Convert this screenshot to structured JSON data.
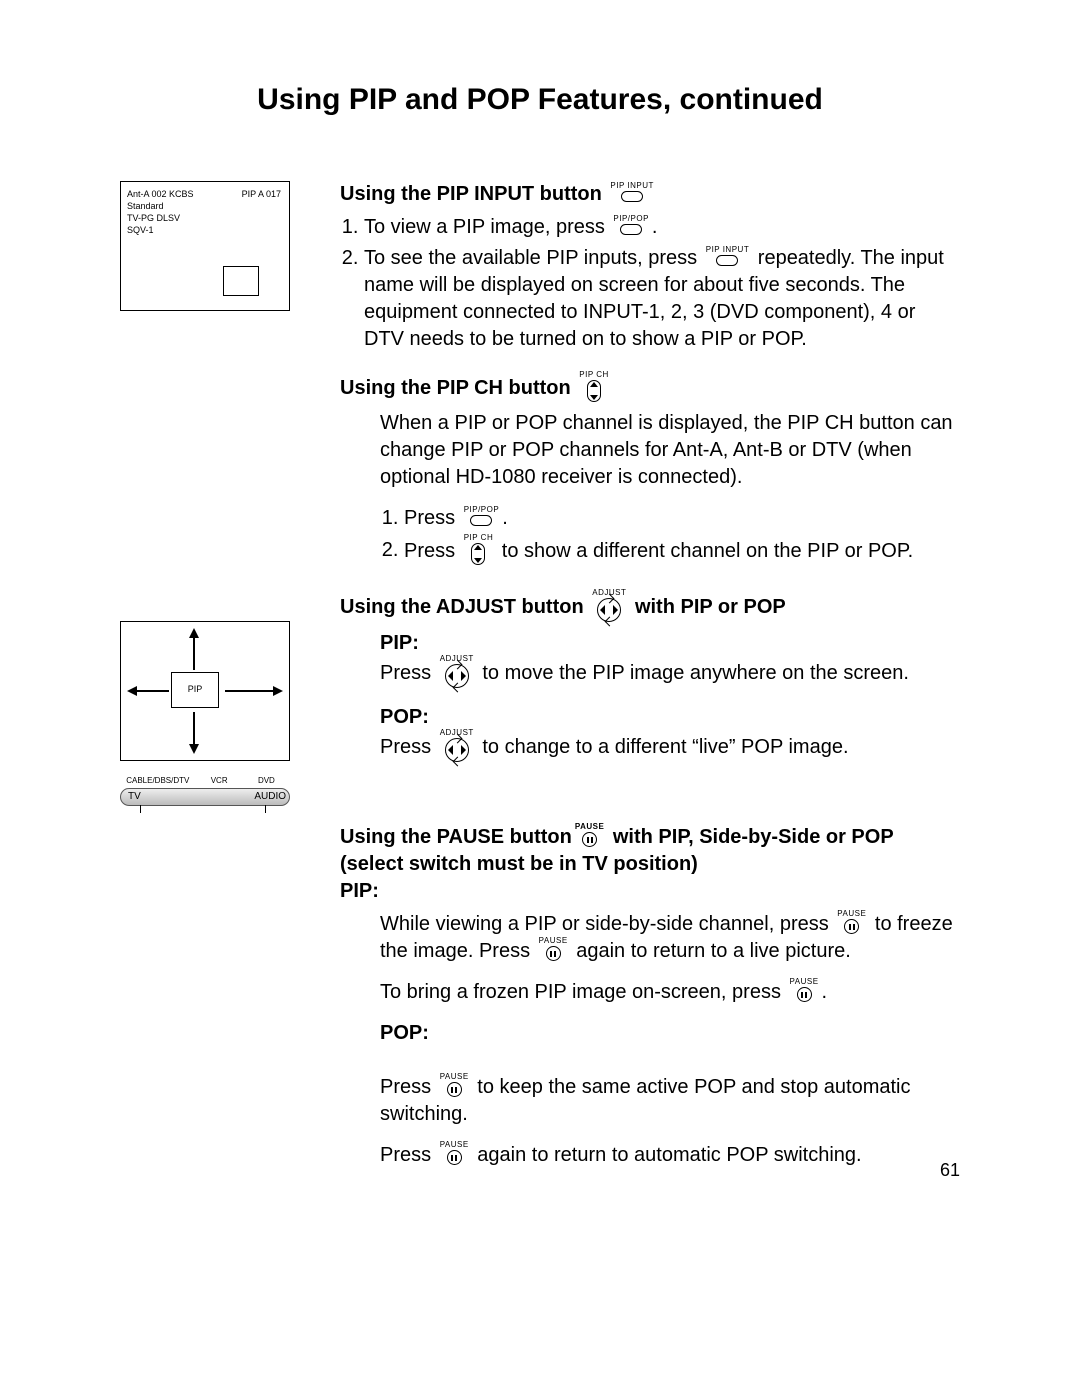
{
  "page_title": "Using PIP and POP Features, continued",
  "page_number": "61",
  "diag1": {
    "tl1": "Ant-A 002 KCBS",
    "tl2": "Standard",
    "tl3": "TV-PG DLSV",
    "tl4": "SQV-1",
    "tr": "PIP A 017"
  },
  "diag2_label": "PIP",
  "switch_labels": [
    "CABLE/DBS/DTV",
    "VCR",
    "DVD",
    "TV",
    "AUDIO"
  ],
  "switch_tv": "TV",
  "switch_audio": "AUDIO",
  "switch_cable": "CABLE/DBS/DTV",
  "switch_vcr": "VCR",
  "switch_dvd": "DVD",
  "icons": {
    "pip_input": "PIP INPUT",
    "pip_pop": "PIP/POP",
    "pip_ch": "PIP CH",
    "adjust": "ADJUST",
    "pause": "PAUSE"
  },
  "sec1_head": "Using the PIP INPUT button",
  "sec1_li1_a": "To view a PIP image, press ",
  "sec1_li1_b": ".",
  "sec1_li2_a": "To see the available PIP inputs, press",
  "sec1_li2_b": "repeatedly.  The input name will be displayed on screen for about five seconds.  The equipment connected to INPUT-1, 2, 3 (DVD component), 4 or DTV needs to be turned on to show a PIP or POP.",
  "sec2_head": "Using the PIP CH button",
  "sec2_p": "When a PIP or POP channel is displayed, the PIP CH button can change PIP or POP channels for Ant-A, Ant-B or DTV (when optional HD-1080 receiver is connected).",
  "sec2_li1_a": "Press ",
  "sec2_li1_b": ".",
  "sec2_li2_a": "Press ",
  "sec2_li2_b": " to show a different channel on the PIP or POP.",
  "sec3_head_a": "Using  the ADJUST button ",
  "sec3_head_b": "with PIP or POP",
  "sec3_pip_label": "PIP:",
  "sec3_pip_a": "Press ",
  "sec3_pip_b": " to move the PIP image anywhere on the screen.",
  "sec3_pop_label": "POP:",
  "sec3_pop_a": "Press ",
  "sec3_pop_b": " to change to a different “live” POP image.",
  "sec4_head_a": "Using the PAUSE button",
  "sec4_head_b": " with PIP, Side-by-Side or POP (select switch must be in TV position)",
  "sec4_pip_label": "PIP:",
  "sec4_pip_p1_a": "While viewing a PIP or side-by-side channel, press ",
  "sec4_pip_p1_b": " to freeze the image.  Press ",
  "sec4_pip_p1_c": " again to return to a live picture.",
  "sec4_pip_p2_a": "To bring a frozen PIP image on-screen, press ",
  "sec4_pip_p2_b": ".",
  "sec4_pop_label": "POP:",
  "sec4_pop_p1_a": "Press ",
  "sec4_pop_p1_b": " to keep the same active POP and stop automatic switching.",
  "sec4_pop_p2_a": "Press ",
  "sec4_pop_p2_b": " again to return to automatic POP switching."
}
